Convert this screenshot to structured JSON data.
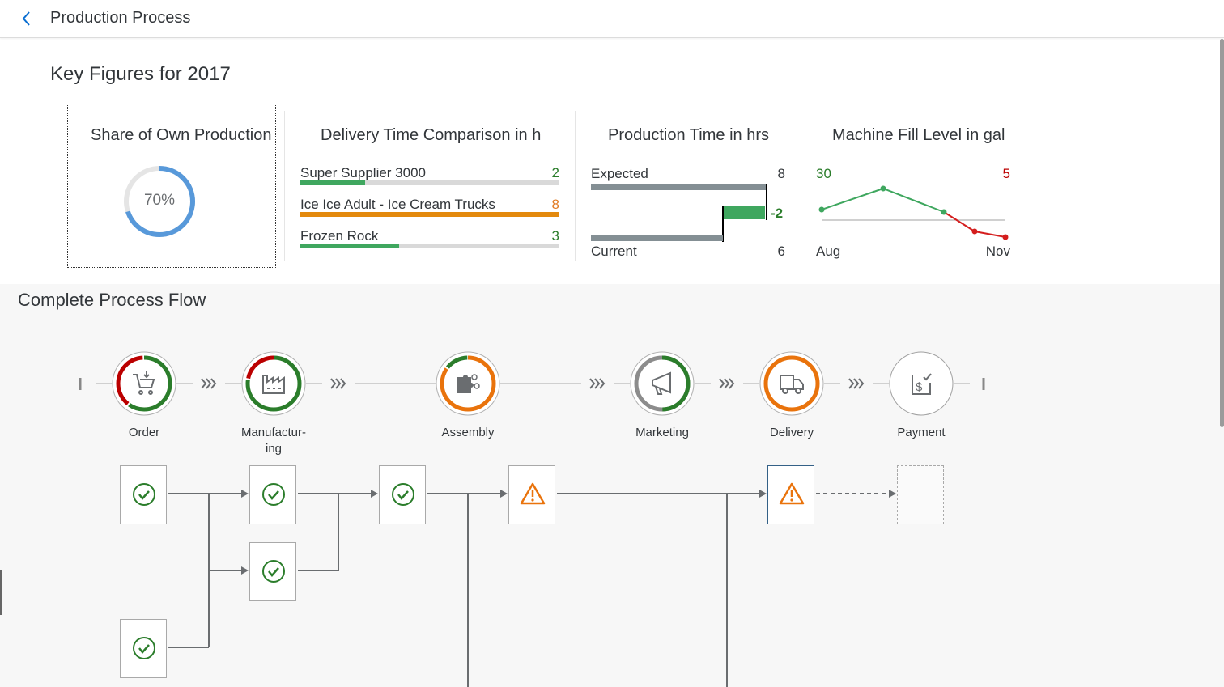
{
  "header": {
    "title": "Production Process"
  },
  "key_figures": {
    "title": "Key Figures for 2017",
    "share_card": {
      "title": "Share of Own Production",
      "percent_label": "70%",
      "percent_value": 70,
      "color": "#5899da"
    },
    "delivery_card": {
      "title": "Delivery Time Comparison in h",
      "rows": [
        {
          "label": "Super Supplier 3000",
          "value": "2",
          "fraction": 0.25,
          "color": "#2b7d2b",
          "bar_color": "#3fa75f"
        },
        {
          "label": "Ice Ice Adult - Ice Cream Trucks",
          "value": "8",
          "fraction": 1.0,
          "color": "#e17b24",
          "bar_color": "#e3890d"
        },
        {
          "label": "Frozen Rock",
          "value": "3",
          "fraction": 0.38,
          "color": "#2b7d2b",
          "bar_color": "#3fa75f"
        }
      ]
    },
    "production_card": {
      "title": "Production Time in hrs",
      "expected_label": "Expected",
      "expected_value": "8",
      "current_label": "Current",
      "current_value": "6",
      "delta_label": "-2",
      "bar_color": "#848f94",
      "delta_color": "#3fa75f"
    },
    "fill_card": {
      "title": "Machine Fill Level in gal",
      "left_value": "30",
      "right_value": "5",
      "left_label": "Aug",
      "right_label": "Nov",
      "left_color": "#2b7d2b",
      "right_color": "#bb0000"
    }
  },
  "process_flow": {
    "title": "Complete Process Flow",
    "lanes": [
      {
        "label": "Order",
        "icon": "cart-icon"
      },
      {
        "label": "Manufactur-\ning",
        "icon": "factory-icon"
      },
      {
        "label": "Assembly",
        "icon": "puzzle-icon"
      },
      {
        "label": "Marketing",
        "icon": "megaphone-icon"
      },
      {
        "label": "Delivery",
        "icon": "truck-icon"
      },
      {
        "label": "Payment",
        "icon": "payment-icon"
      }
    ],
    "colors": {
      "positive": "#2b7d2b",
      "critical": "#e9730c",
      "negative": "#bb0000",
      "neutral": "#8c8c8c"
    }
  }
}
